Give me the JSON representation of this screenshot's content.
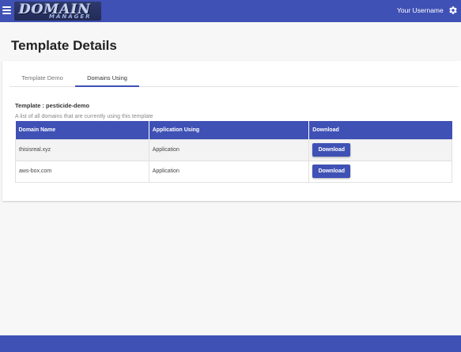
{
  "header": {
    "logo_line1": "DOMAIN",
    "logo_line2": "MANAGER",
    "username": "Your Username",
    "menu_icon": "hamburger-icon",
    "settings_icon": "gear-icon"
  },
  "page": {
    "title": "Template Details"
  },
  "tabs": [
    {
      "label": "Template Demo",
      "active": false
    },
    {
      "label": "Domains Using",
      "active": true
    }
  ],
  "template": {
    "label": "Template : pesticide-demo",
    "description": "A list of all domains that are currently using this template"
  },
  "table": {
    "headers": [
      "Domain Name",
      "Application Using",
      "Download"
    ],
    "rows": [
      {
        "domain": "thisisreal.xyz",
        "application": "Application",
        "action": "Download"
      },
      {
        "domain": "aws-box.com",
        "application": "Application",
        "action": "Download"
      }
    ]
  },
  "colors": {
    "primary": "#3f51b5",
    "background": "#f7f7f7"
  }
}
